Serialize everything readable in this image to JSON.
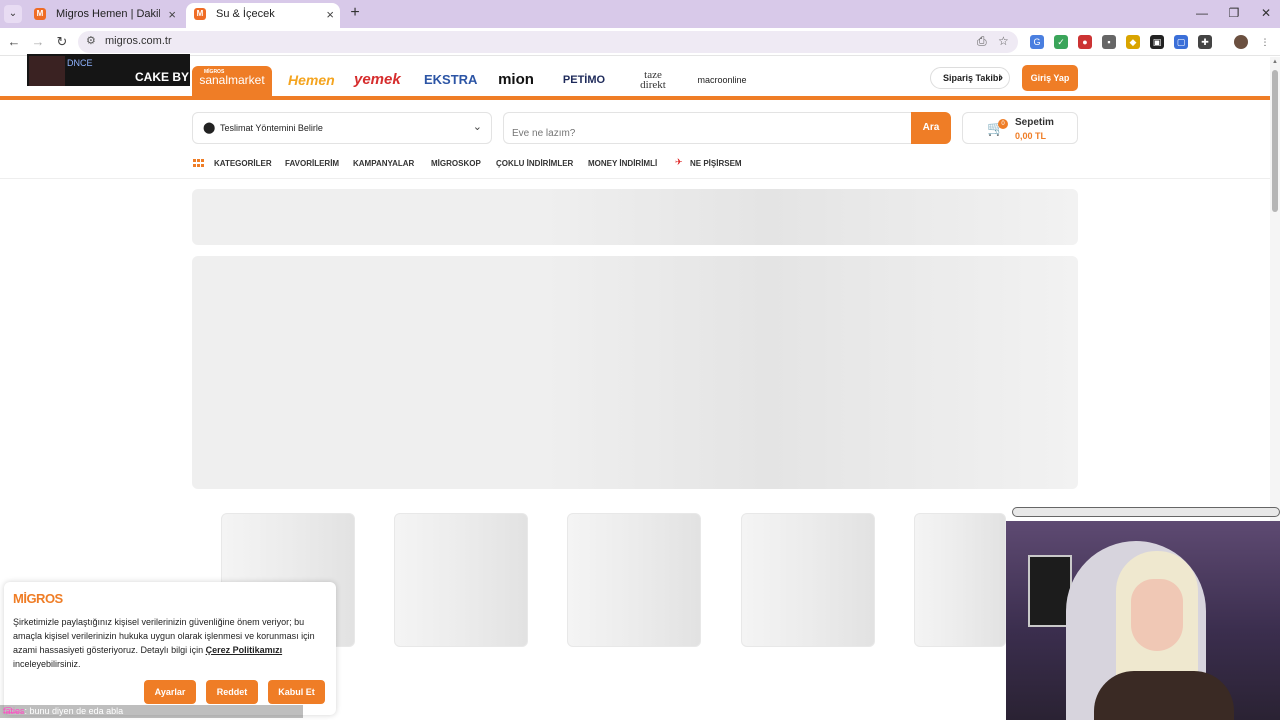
{
  "browser": {
    "tabs": [
      {
        "title": "Migros Hemen | Dakikalar İçinde",
        "active": false
      },
      {
        "title": "Su & İçecek",
        "active": true
      }
    ],
    "url": "migros.com.tr",
    "close_glyph": "×",
    "new_tab_glyph": "+"
  },
  "header": {
    "brands": [
      {
        "id": "sanalmarket",
        "label": "sanalmarket",
        "sub": "MİGROS"
      },
      {
        "id": "hemen",
        "label": "Hemen"
      },
      {
        "id": "yemek",
        "label": "yemek"
      },
      {
        "id": "ekstra",
        "label": "EKSTRA"
      },
      {
        "id": "mion",
        "label": "mion"
      },
      {
        "id": "petimo",
        "label": "PETİMO"
      },
      {
        "id": "taze",
        "label": "taze direkt"
      },
      {
        "id": "macro",
        "label": "macroonline"
      }
    ],
    "order_tracking": "Sipariş Takibi",
    "login": "Giriş Yap"
  },
  "stream_overlay": {
    "tag": "DNCE",
    "song": "CAKE BY T"
  },
  "search": {
    "delivery_label": "Teslimat Yöntemini Belirle",
    "placeholder": "Eve ne lazım?",
    "button": "Ara"
  },
  "cart": {
    "title": "Sepetim",
    "count": "0",
    "total": "0,00 TL"
  },
  "categories": [
    "KATEGORİLER",
    "FAVORİLERİM",
    "KAMPANYALAR",
    "MİGROSKOP",
    "ÇOKLU İNDİRİMLER",
    "MONEY İNDİRİMLİ",
    "NE PİŞİRSEM"
  ],
  "cookie": {
    "logo": "MİGROS",
    "text_before": "Şirketimizle paylaştığınız kişisel verilerinizin güvenliğine önem veriyor; bu amaçla kişisel verilerinizin hukuka uygun olarak işlenmesi ve korunması için azami hassasiyeti gösteriyoruz. Detaylı bilgi için ",
    "link": "Çerez Politikamızı",
    "text_after": " inceleyebilirsiniz.",
    "buttons": [
      "Ayarlar",
      "Reddet",
      "Kabul Et"
    ]
  },
  "chat": {
    "user": "f̶͡a̶̶t̶i̶e̶s",
    "message": "bunu diyen de eda abla"
  },
  "colors": {
    "accent": "#ef7d26",
    "tabbar": "#d8c9e9"
  },
  "icons": {
    "back": "back-arrow-icon",
    "forward": "forward-arrow-icon",
    "reload": "reload-icon",
    "pin": "location-pin-icon",
    "cart": "cart-icon",
    "chevron": "chevron-down-icon"
  }
}
